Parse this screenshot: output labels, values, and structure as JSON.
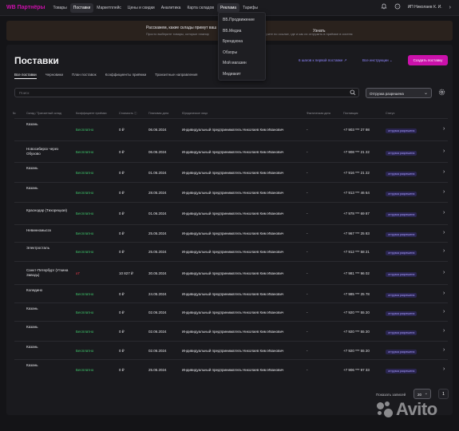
{
  "topnav": {
    "logo": "WB Партнёры",
    "items": [
      "Товары",
      "Поставки",
      "Маркетплейс",
      "Цены и скидки",
      "Аналитика",
      "Карта складов",
      "Реклама",
      "Тарифы"
    ],
    "user": "ИП Николаев К. И.",
    "user_chevron": "›"
  },
  "dropdown": {
    "items": [
      "ВБ.Продвижение",
      "ВБ.Медиа",
      "Брендзона",
      "Обзоры",
      "Мой магазин",
      "Медиакит"
    ]
  },
  "banner": {
    "title": "Расскажем, какие склады примут ваш",
    "subtitle": "Просто выберите товары, которые планир",
    "subtitle_tail": "и посмотрите по ссылке, где и как их отгрузить в приёмке в систем",
    "link": "Узнать"
  },
  "page": {
    "title": "Поставки",
    "steps_link": "6 шагов к первой поставке",
    "instructions_link": "Все инструкции",
    "create_button": "Создать поставку",
    "tabs": [
      "Все поставки",
      "Черновики",
      "План поставок",
      "Коэффициенты приёмки",
      "Транзитные направления"
    ],
    "search_placeholder": "Поиск",
    "status_filter": "Отгрузка разрешена"
  },
  "table": {
    "headers": {
      "warehouse": "Склад / Транзитный склад",
      "coef": "Коэффициент приёмки",
      "cost": "Стоимость",
      "date": "Плановая дата",
      "legal": "Юридическое лицо",
      "fact": "Фактическая дата",
      "sender": "Поставщик",
      "status": "Статус",
      "num": "№"
    },
    "rows": [
      {
        "warehouse": "Казань",
        "coef": "Бесплатно",
        "cost": "0 ₽",
        "date": "06.06.2024",
        "legal": "Индивидуальный предприниматель Николаев Ким Иванович",
        "fact": "-",
        "phone": "+7 903 *** 27 98",
        "status": "отгрузка разрешена"
      },
      {
        "warehouse": "Новосибирск через Обухово",
        "coef": "Бесплатно",
        "cost": "0 ₽",
        "date": "06.06.2024",
        "legal": "Индивидуальный предприниматель Николаев Ким Иванович",
        "fact": "-",
        "phone": "+7 908 *** 21 22",
        "status": "отгрузка разрешена"
      },
      {
        "warehouse": "Казань",
        "coef": "Бесплатно",
        "cost": "0 ₽",
        "date": "01.06.2024",
        "legal": "Индивидуальный предприниматель Николаев Ким Иванович",
        "fact": "-",
        "phone": "+7 916 *** 21 22",
        "status": "отгрузка разрешена"
      },
      {
        "warehouse": "Казань",
        "coef": "Бесплатно",
        "cost": "0 ₽",
        "date": "28.05.2024",
        "legal": "Индивидуальный предприниматель Николаев Ким Иванович",
        "fact": "-",
        "phone": "+7 913 *** 46 64",
        "status": "отгрузка разрешена"
      },
      {
        "warehouse": "Краснодар (Тихорецкая)",
        "coef": "Бесплатно",
        "cost": "0 ₽",
        "date": "01.06.2024",
        "legal": "Индивидуальный предприниматель Николаев Ким Иванович",
        "fact": "-",
        "phone": "+7 978 *** 69 87",
        "status": "отгрузка разрешена"
      },
      {
        "warehouse": "Невинномысск",
        "coef": "Бесплатно",
        "cost": "0 ₽",
        "date": "25.05.2024",
        "legal": "Индивидуальный предприниматель Николаев Ким Иванович",
        "fact": "-",
        "phone": "+7 967 *** 25 83",
        "status": "отгрузка разрешена"
      },
      {
        "warehouse": "Электросталь",
        "coef": "Бесплатно",
        "cost": "0 ₽",
        "date": "25.05.2024",
        "legal": "Индивидуальный предприниматель Николаев Ким Иванович",
        "fact": "-",
        "phone": "+7 912 *** 58 21",
        "status": "отгрузка разрешена"
      },
      {
        "warehouse": "Санкт-Петербург (Уткина Заводь)",
        "coef": "x7",
        "cost": "10 827 ₽",
        "date": "30.05.2024",
        "legal": "Индивидуальный предприниматель Николаев Ким Иванович",
        "fact": "-",
        "phone": "+7 981 *** 96 02",
        "status": "отгрузка разрешена"
      },
      {
        "warehouse": "Коледино",
        "coef": "Бесплатно",
        "cost": "0 ₽",
        "date": "24.05.2024",
        "legal": "Индивидуальный предприниматель Николаев Ким Иванович",
        "fact": "-",
        "phone": "+7 985 *** 25 78",
        "status": "отгрузка разрешена"
      },
      {
        "warehouse": "Казань",
        "coef": "Бесплатно",
        "cost": "0 ₽",
        "date": "02.06.2024",
        "legal": "Индивидуальный предприниматель Николаев Ким Иванович",
        "fact": "-",
        "phone": "+7 920 *** 55 20",
        "status": "отгрузка разрешена"
      },
      {
        "warehouse": "Казань",
        "coef": "Бесплатно",
        "cost": "0 ₽",
        "date": "02.06.2024",
        "legal": "Индивидуальный предприниматель Николаев Ким Иванович",
        "fact": "-",
        "phone": "+7 920 *** 55 20",
        "status": "отгрузка разрешена"
      },
      {
        "warehouse": "Казань",
        "coef": "Бесплатно",
        "cost": "0 ₽",
        "date": "02.06.2024",
        "legal": "Индивидуальный предприниматель Николаев Ким Иванович",
        "fact": "-",
        "phone": "+7 920 *** 55 20",
        "status": "отгрузка разрешена"
      },
      {
        "warehouse": "Казань",
        "coef": "Бесплатно",
        "cost": "0 ₽",
        "date": "25.05.2024",
        "legal": "Индивидуальный предприниматель Николаев Ким Иванович",
        "fact": "-",
        "phone": "+7 906 *** 97 33",
        "status": "отгрузка разрешена"
      }
    ]
  },
  "footer": {
    "per_page_label": "Показать записей",
    "per_page_value": "20",
    "page": "1"
  },
  "watermark": "Avito",
  "colors": {
    "accent": "#cb11ab",
    "free": "#3ec76b",
    "link": "#8f86ff",
    "badge": "#a79bff"
  }
}
